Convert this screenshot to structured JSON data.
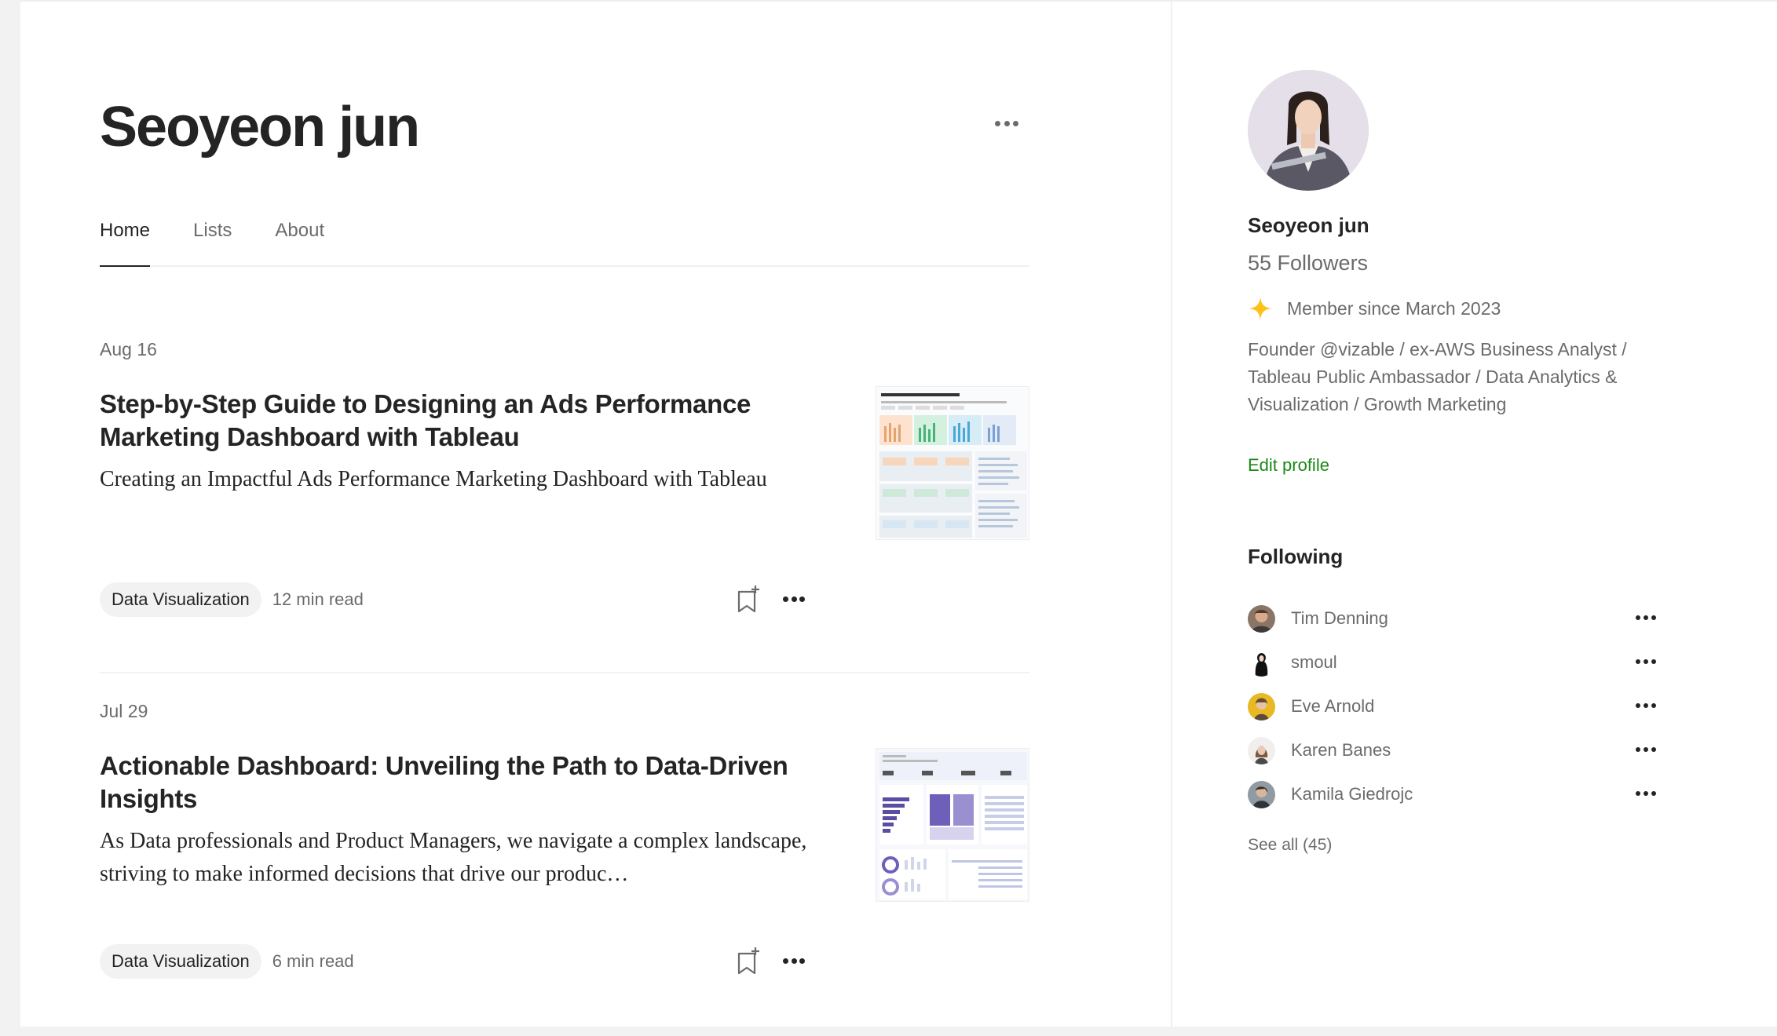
{
  "profile": {
    "name": "Seoyeon jun"
  },
  "tabs": [
    {
      "label": "Home",
      "active": true
    },
    {
      "label": "Lists",
      "active": false
    },
    {
      "label": "About",
      "active": false
    }
  ],
  "articles": [
    {
      "date": "Aug 16",
      "title": "Step-by-Step Guide to Designing an Ads Performance Marketing Dashboard with Tableau",
      "subtitle": "Creating an Impactful Ads Performance Marketing Dashboard with Tableau",
      "tag": "Data Visualization",
      "read_time": "12 min read"
    },
    {
      "date": "Jul 29",
      "title": "Actionable Dashboard: Unveiling the Path to Data-Driven Insights",
      "subtitle": "As Data professionals and Product Managers, we navigate a complex landscape, striving to make informed decisions that drive our produc…",
      "tag": "Data Visualization",
      "read_time": "6 min read"
    }
  ],
  "sidebar": {
    "name": "Seoyeon jun",
    "followers": "55 Followers",
    "member_since": "Member since March 2023",
    "bio": "Founder @vizable / ex-AWS Business Analyst / Tableau Public Ambassador / Data Analytics & Visualization / Growth Marketing",
    "edit_profile": "Edit profile",
    "following_title": "Following",
    "following": [
      {
        "name": "Tim Denning"
      },
      {
        "name": "smoul"
      },
      {
        "name": "Eve Arnold"
      },
      {
        "name": "Karen Banes"
      },
      {
        "name": "Kamila Giedrojc"
      }
    ],
    "see_all": "See all (45)"
  },
  "colors": {
    "accent_green": "#1a8917",
    "member_star": "#ffc017",
    "text_primary": "#242424",
    "text_secondary": "#6b6b6b"
  },
  "icons": {
    "header_more": "more-horizontal-icon",
    "bookmark": "bookmark-add-icon",
    "member_star": "sparkle-star-icon"
  }
}
